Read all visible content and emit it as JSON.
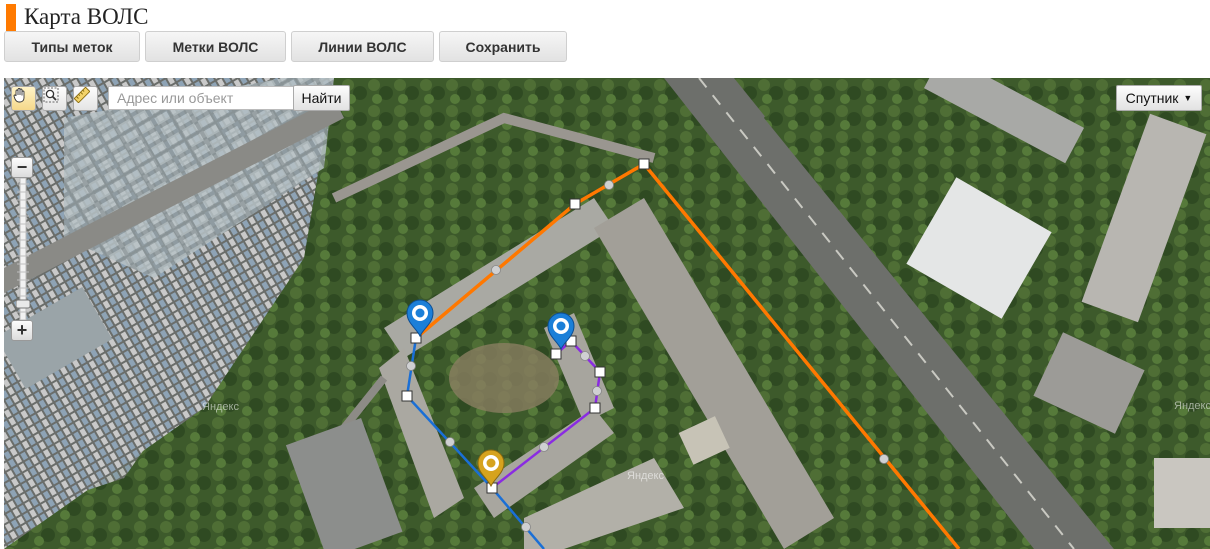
{
  "header": {
    "title": "Карта ВОЛС",
    "accent_color": "#ff7a00"
  },
  "toolbar": {
    "buttons": [
      {
        "label": "Типы меток"
      },
      {
        "label": "Метки ВОЛС"
      },
      {
        "label": "Линии ВОЛС"
      },
      {
        "label": "Сохранить"
      }
    ]
  },
  "map": {
    "tools": [
      {
        "icon": "hand-icon",
        "active": true
      },
      {
        "icon": "magnifier-icon",
        "active": false
      },
      {
        "icon": "ruler-icon",
        "active": false
      }
    ],
    "search": {
      "placeholder": "Адрес или объект",
      "value": "",
      "button_label": "Найти"
    },
    "layer_select": {
      "selected": "Спутник"
    },
    "zoom": {
      "plus": "+",
      "minus": "−"
    },
    "watermark": "Яндекс",
    "line_colors": {
      "orange": "#ff7800",
      "blue": "#1a6fd6",
      "purple": "#8a2be2"
    },
    "marker_colors": {
      "blue": "#1b7fd8",
      "gold": "#d6a31e"
    }
  }
}
